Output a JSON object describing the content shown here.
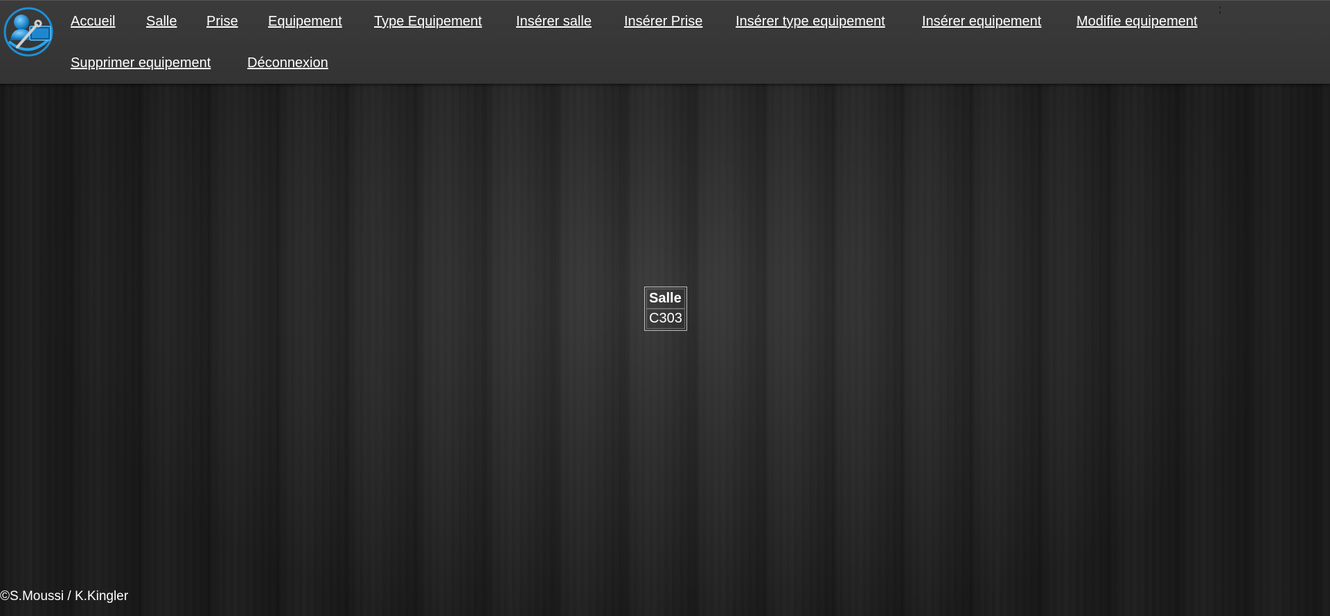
{
  "nav": {
    "items": [
      {
        "label": "Accueil"
      },
      {
        "label": "Salle"
      },
      {
        "label": "Prise"
      },
      {
        "label": "Equipement"
      },
      {
        "label": "Type Equipement"
      },
      {
        "label": "Insérer salle"
      },
      {
        "label": "Insérer Prise"
      },
      {
        "label": "Insérer type equipement"
      },
      {
        "label": "Insérer equipement"
      },
      {
        "label": "Modifie equipement"
      },
      {
        "label": "Supprimer equipement"
      },
      {
        "label": "Déconnexion"
      }
    ],
    "stray_char": ";"
  },
  "logo": {
    "icon": "tools-computer-logo-icon"
  },
  "salle_table": {
    "header": "Salle",
    "rows": [
      "C303"
    ]
  },
  "footer": {
    "text": "©S.Moussi / K.Kingler"
  }
}
